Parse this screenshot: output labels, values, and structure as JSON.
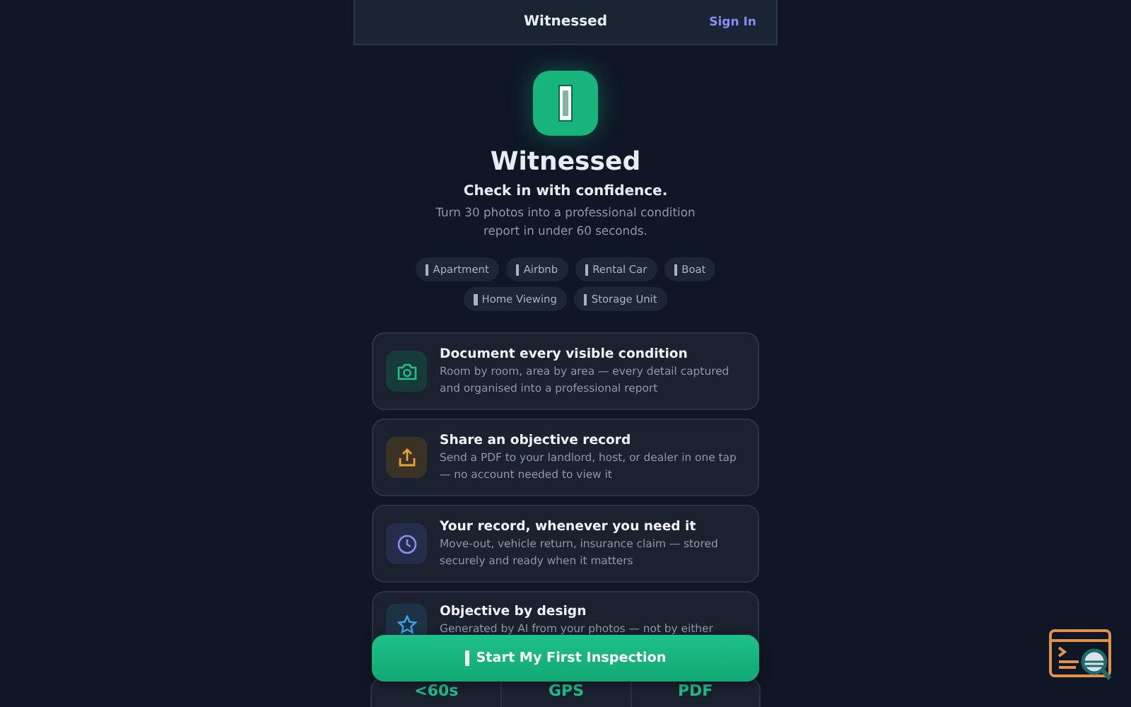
{
  "header": {
    "title": "Witnessed",
    "sign_in": "Sign In"
  },
  "hero": {
    "title": "Witnessed",
    "tagline": "Check in with confidence.",
    "description": "Turn 30 photos into a professional condition report in under 60 seconds."
  },
  "chips": [
    {
      "label": "Apartment"
    },
    {
      "label": "Airbnb"
    },
    {
      "label": "Rental Car"
    },
    {
      "label": "Boat"
    },
    {
      "label": "Home Viewing"
    },
    {
      "label": "Storage Unit"
    }
  ],
  "features": [
    {
      "kind": "camera",
      "title": "Document every visible condition",
      "description": "Room by room, area by area — every detail captured and organised into a professional report"
    },
    {
      "kind": "share",
      "title": "Share an objective record",
      "description": "Send a PDF to your landlord, host, or dealer in one tap — no account needed to view it"
    },
    {
      "kind": "clock",
      "title": "Your record, whenever you need it",
      "description": "Move-out, vehicle return, insurance claim — stored securely and ready when it matters"
    },
    {
      "kind": "star",
      "title": "Objective by design",
      "description": "Generated by AI from your photos — not by either"
    }
  ],
  "cta": {
    "label": "Start My First Inspection"
  },
  "stats": [
    {
      "value": "<60s"
    },
    {
      "value": "GPS"
    },
    {
      "value": "PDF"
    }
  ]
}
